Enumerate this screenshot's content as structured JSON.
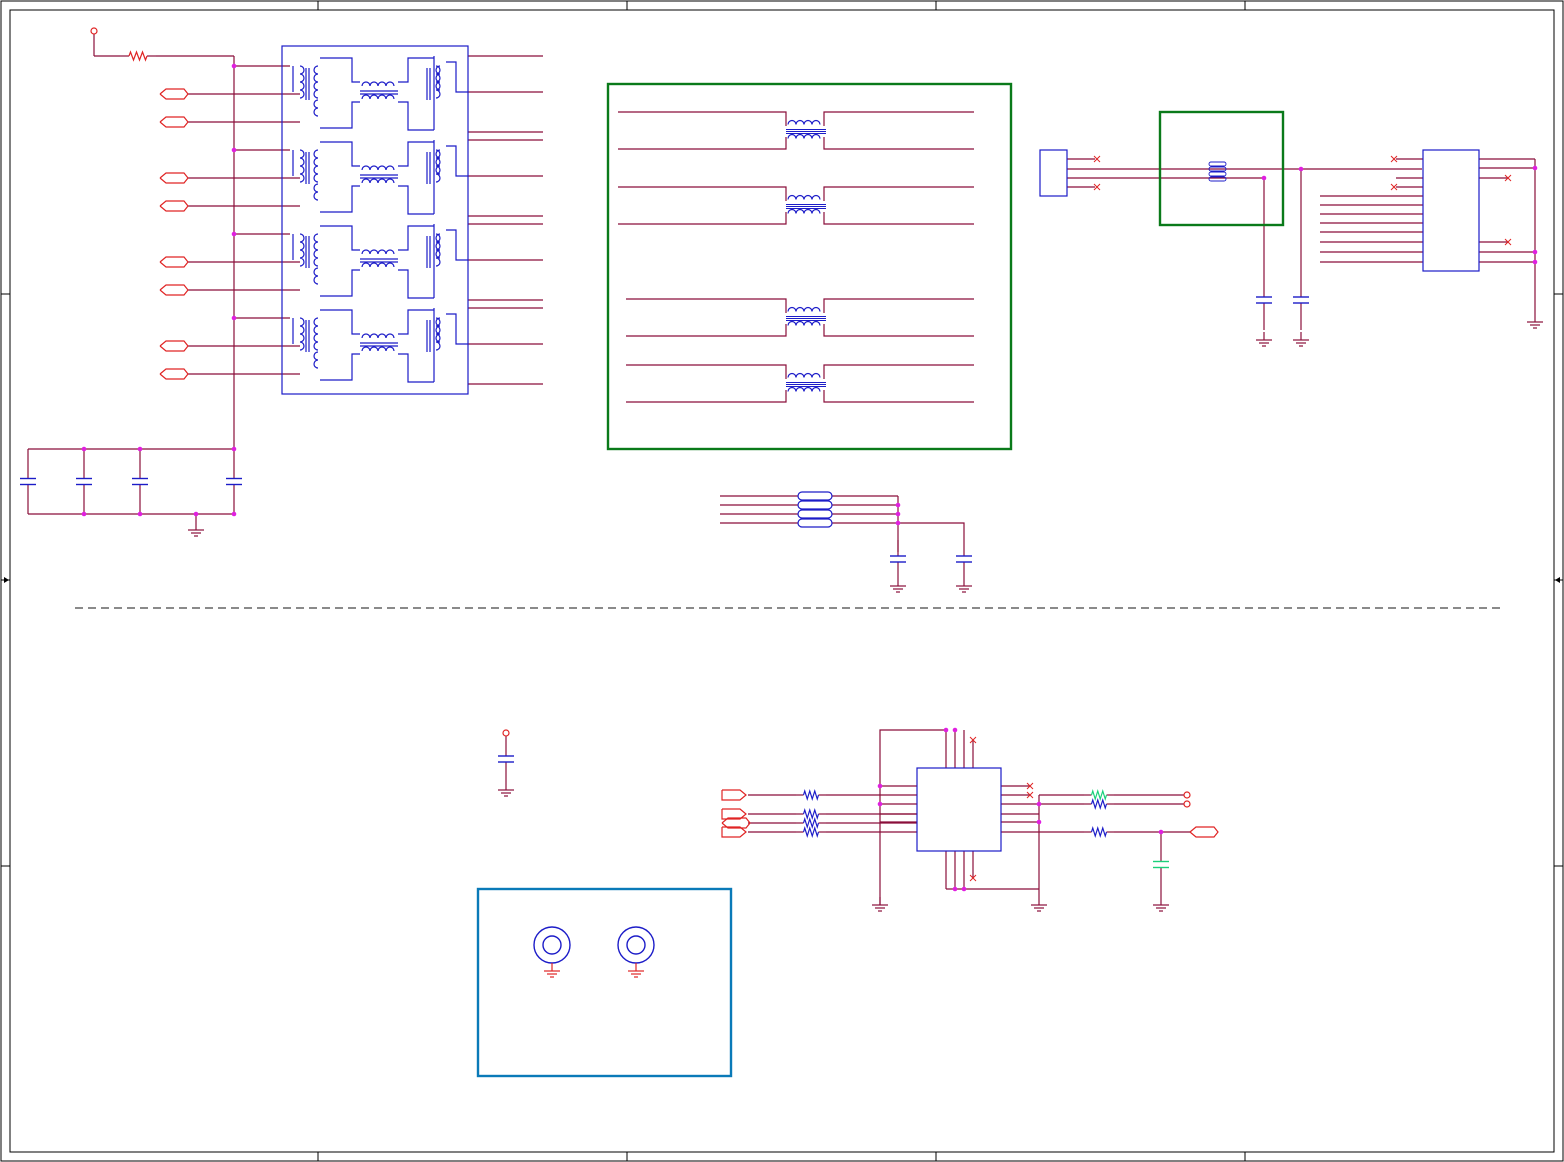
{
  "colors": {
    "wire": "#8a0f3a",
    "pin": "#e02424",
    "part": "#1c1cc8",
    "junction": "#e020e0",
    "green_box": "#0a7a1a",
    "blue_box": "#0a7ab8",
    "teal_part": "#1ad07a",
    "frame": "#000000",
    "separator": "#444444"
  }
}
